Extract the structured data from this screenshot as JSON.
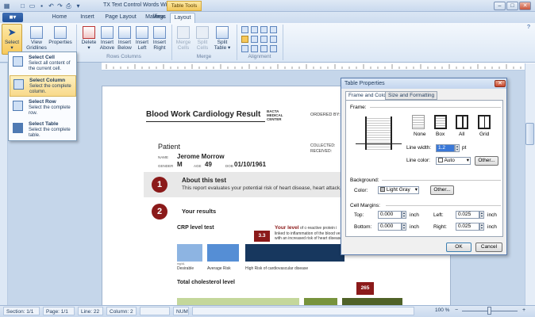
{
  "window": {
    "title": "TX Text Control Words Windows For...",
    "contextual_group": "Table Tools",
    "minimize": "–",
    "maximize": "□",
    "close": "✕"
  },
  "tabs": [
    {
      "label": "Home"
    },
    {
      "label": "Insert"
    },
    {
      "label": "Page Layout"
    },
    {
      "label": "Mailings"
    },
    {
      "label": "View"
    },
    {
      "label": "Layout"
    }
  ],
  "file_menu": "■▾",
  "ribbon": {
    "select": "Select",
    "view_gridlines": [
      "View",
      "Gridlines"
    ],
    "properties": "Properties",
    "delete": "Delete",
    "insert_above": [
      "Insert",
      "Above"
    ],
    "insert_below": [
      "Insert",
      "Below"
    ],
    "insert_left": [
      "Insert",
      "Left"
    ],
    "insert_right": [
      "Insert",
      "Right"
    ],
    "rows_columns_label": "Rows Columns",
    "merge_cells": [
      "Merge",
      "Cells"
    ],
    "split_cells": [
      "Split",
      "Cells"
    ],
    "split_table": [
      "Split",
      "Table ▾"
    ],
    "merge_label": "Merge",
    "alignment_label": "Alignment"
  },
  "dropdown": {
    "items": [
      {
        "title": "Select Cell",
        "desc": "Select all content of the current cell."
      },
      {
        "title": "Select Column",
        "desc": "Select the complete column."
      },
      {
        "title": "Select Row",
        "desc": "Select the complete row."
      },
      {
        "title": "Select Table",
        "desc": "Select the complete table."
      }
    ]
  },
  "dialog": {
    "title": "Table Properties",
    "tabs": [
      "Frame and Color",
      "Size and Formatting"
    ],
    "frame_label": "Frame:",
    "presets": [
      "None",
      "Box",
      "All",
      "Grid"
    ],
    "line_width_label": "Line width:",
    "line_width_value": "1.2",
    "line_width_unit": "pt",
    "line_color_label": "Line color:",
    "line_color_value": "Auto",
    "other_1": "Other...",
    "background_label": "Background:",
    "color_label": "Color:",
    "color_value": "Light Gray",
    "other_2": "Other...",
    "cell_margins_label": "Cell Margins:",
    "top_label": "Top:",
    "top_value": "0.000",
    "bottom_label": "Bottom:",
    "bottom_value": "0.000",
    "left_label": "Left:",
    "left_value": "0.025",
    "right_label": "Right:",
    "right_value": "0.025",
    "unit": "inch",
    "ok": "OK",
    "cancel": "Cancel"
  },
  "document": {
    "title": "Blood Work Cardiology Result",
    "company": "BACTA MEDICAL CENTER",
    "ordered_by": "ORDERED BY:",
    "patient_heading": "Patient",
    "name_label": "NAME",
    "name_value": "Jerome Morrow",
    "gender_label": "GENDER",
    "gender_value": "M",
    "age_label": "AGE",
    "age_value": "49",
    "dob_label": "DOB",
    "dob_value": "01/10/1961",
    "collected": "COLLECTED:",
    "received": "RECEIVED:",
    "section1_num": "1",
    "section1_title": "About this test",
    "section1_text": "This report evaluates your potential risk of heart disease, heart attack, an",
    "section2_num": "2",
    "section2_title": "Your results",
    "crp_heading": "CRP level test",
    "crp_value": "3.3",
    "crp_level_bold": "Your level",
    "crp_level_text": " of c-reactive protein i",
    "crp_line2": "linked to inflammation of the blood ve",
    "crp_line3": "with an increased risk of heart disease",
    "bar_small_label": "mg/dL",
    "bar_labels": [
      "Desirable",
      "Average Risk",
      "High Risk of cardiovascular disease"
    ],
    "cholesterol_heading": "Total cholesterol level",
    "cholesterol_value": "265"
  },
  "status": {
    "section": "Section: 1/1",
    "page": "Page: 1/1",
    "line": "Line: 22",
    "column": "Column: 2",
    "num": "NUM",
    "zoom": "100 %"
  },
  "colors": {
    "accent_dark_red": "#8b1a1a",
    "bar_light": "#8db4e2",
    "bar_mid": "#558ed5",
    "bar_dark": "#17375e",
    "chol_light": "#c4d79b",
    "chol_mid": "#77933c",
    "chol_dark": "#4f6228"
  }
}
